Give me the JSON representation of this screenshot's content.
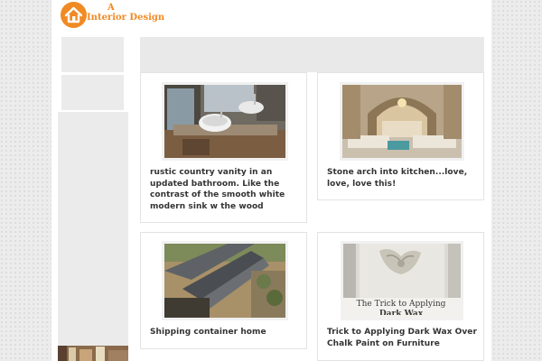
{
  "logo": {
    "line1": "A",
    "line2": "Interior Design"
  },
  "colors": {
    "accent": "#f08a24",
    "panel": "#ebebeb",
    "card_border": "#e3e3e3"
  },
  "icons": {
    "logo": "house-icon"
  },
  "cards": [
    {
      "title": "rustic country vanity in an updated bathroom. Like the contrast of the smooth white modern sink w the wood"
    },
    {
      "title": "Stone arch into kitchen...love, love, love this!"
    },
    {
      "title": "Shipping container home"
    },
    {
      "title": "Trick to Applying Dark Wax Over Chalk Paint on Furniture",
      "image_caption_line1": "The Trick to Applying",
      "image_caption_line2": "Dark Wax"
    }
  ]
}
